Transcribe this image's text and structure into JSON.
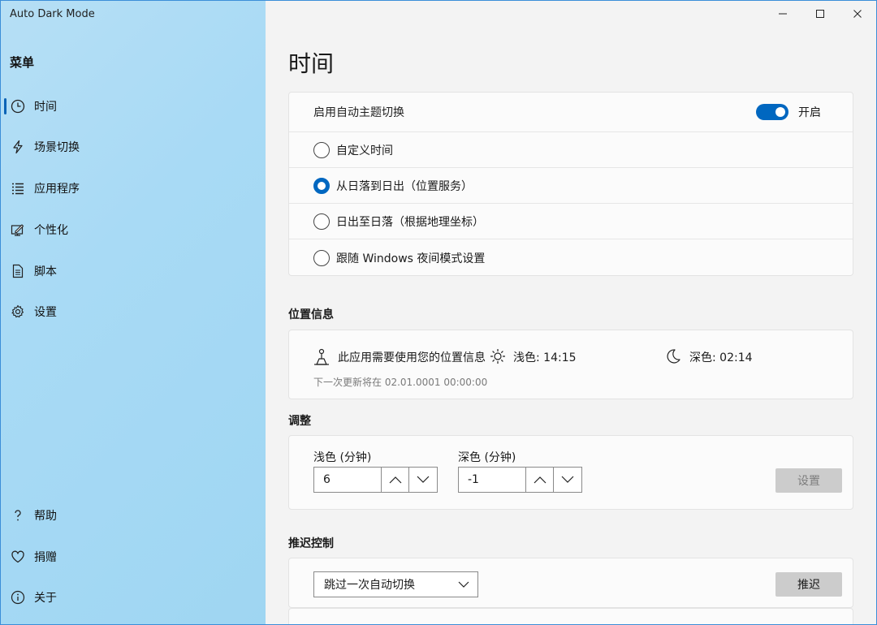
{
  "window": {
    "title": "Auto Dark Mode",
    "controls": {
      "minimize": "minimize",
      "maximize": "maximize",
      "close": "close"
    }
  },
  "sidebar": {
    "heading": "菜单",
    "items": [
      {
        "label": "时间",
        "icon": "clock-icon",
        "selected": true
      },
      {
        "label": "场景切换",
        "icon": "lightning-icon",
        "selected": false
      },
      {
        "label": "应用程序",
        "icon": "list-icon",
        "selected": false
      },
      {
        "label": "个性化",
        "icon": "personalize-icon",
        "selected": false
      },
      {
        "label": "脚本",
        "icon": "document-icon",
        "selected": false
      },
      {
        "label": "设置",
        "icon": "gear-icon",
        "selected": false
      }
    ],
    "bottom_items": [
      {
        "label": "帮助",
        "icon": "question-icon"
      },
      {
        "label": "捐赠",
        "icon": "heart-icon"
      },
      {
        "label": "关于",
        "icon": "info-icon"
      }
    ]
  },
  "main": {
    "title": "时间",
    "auto_switch": {
      "label": "启用自动主题切换",
      "toggle_state": "开启",
      "toggle_on": true,
      "options": [
        {
          "label": "自定义时间",
          "checked": false
        },
        {
          "label": "从日落到日出（位置服务）",
          "checked": true
        },
        {
          "label": "日出至日落（根据地理坐标）",
          "checked": false
        },
        {
          "label": "跟随 Windows 夜间模式设置",
          "checked": false
        }
      ]
    },
    "location": {
      "heading": "位置信息",
      "message": "此应用需要使用您的位置信息",
      "light_time": "浅色: 14:15",
      "dark_time": "深色: 02:14",
      "next_update": "下一次更新将在 02.01.0001 00:00:00"
    },
    "adjust": {
      "heading": "调整",
      "light_label": "浅色 (分钟)",
      "light_value": "6",
      "dark_label": "深色 (分钟)",
      "dark_value": "-1",
      "set_button": "设置"
    },
    "postpone": {
      "heading": "推迟控制",
      "dropdown_value": "跳过一次自动切换",
      "postpone_button": "推迟"
    }
  },
  "colors": {
    "accent": "#0067c0",
    "sidebar_bg": "#a8daf5",
    "main_bg": "#f3f3f3",
    "card_bg": "#fbfbfb"
  }
}
